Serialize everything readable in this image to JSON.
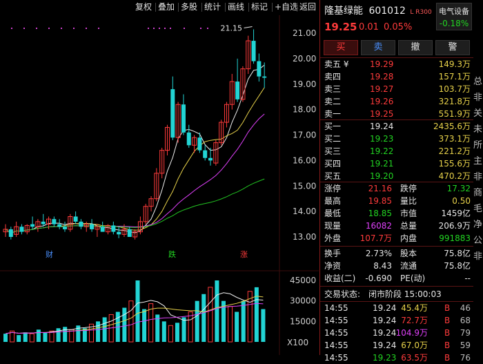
{
  "toolbar": {
    "buttons": [
      "复权",
      "叠加",
      "多股",
      "统计",
      "画线",
      "标记",
      "+自选",
      "返回"
    ]
  },
  "stock": {
    "name": "隆基绿能",
    "code": "601012",
    "tags": "L R300",
    "price": "19.25",
    "change": "0.01",
    "pct": "0.05%",
    "sector": "电气设备",
    "sector_pct": "-0.18%"
  },
  "trade_buttons": [
    "买",
    "卖",
    "撤",
    "警"
  ],
  "ask": [
    {
      "label": "卖五 ¥",
      "price": "19.29",
      "vol": "149.3万"
    },
    {
      "label": "卖四",
      "price": "19.28",
      "vol": "157.1万"
    },
    {
      "label": "卖三",
      "price": "19.27",
      "vol": "103.7万"
    },
    {
      "label": "卖二",
      "price": "19.26",
      "vol": "321.8万"
    },
    {
      "label": "卖一",
      "price": "19.25",
      "vol": "551.9万"
    }
  ],
  "bid": [
    {
      "label": "买一",
      "price": "19.24",
      "vol": "2435.6万"
    },
    {
      "label": "买二",
      "price": "19.23",
      "vol": "373.1万"
    },
    {
      "label": "买三",
      "price": "19.22",
      "vol": "221.2万"
    },
    {
      "label": "买四",
      "price": "19.21",
      "vol": "155.6万"
    },
    {
      "label": "买五",
      "price": "19.20",
      "vol": "470.2万"
    }
  ],
  "stats": [
    {
      "l1": "涨停",
      "v1": "21.16",
      "c1": "red",
      "l2": "跌停",
      "v2": "17.32",
      "c2": "green"
    },
    {
      "l1": "最高",
      "v1": "19.85",
      "c1": "red",
      "l2": "量比",
      "v2": "0.50",
      "c2": "yellow"
    },
    {
      "l1": "最低",
      "v1": "18.85",
      "c1": "green",
      "l2": "市值",
      "v2": "1459亿",
      "c2": "white"
    },
    {
      "l1": "现量",
      "v1": "16082",
      "c1": "mag",
      "l2": "总量",
      "v2": "206.9万",
      "c2": "white"
    },
    {
      "l1": "外盘",
      "v1": "107.7万",
      "c1": "red",
      "l2": "内盘",
      "v2": "991883",
      "c2": "green"
    }
  ],
  "stats2": [
    {
      "l1": "换手",
      "v1": "2.73%",
      "l2": "股本",
      "v2": "75.8亿"
    },
    {
      "l1": "净资",
      "v1": "8.43",
      "l2": "流通",
      "v2": "75.8亿"
    },
    {
      "l1": "收益(二)",
      "v1": "-0.690",
      "l2": "PE(动)",
      "v2": "--"
    }
  ],
  "status": {
    "label": "交易状态:",
    "value": "闭市阶段 15:00:03"
  },
  "ticks": [
    {
      "time": "14:55",
      "price": "19.24",
      "vol": "45.4万",
      "side": "B",
      "n": "46"
    },
    {
      "time": "14:55",
      "price": "19.24",
      "vol": "72.7万",
      "side": "B",
      "n": "68"
    },
    {
      "time": "14:55",
      "price": "19.24",
      "vol": "104.9万",
      "side": "B",
      "n": "79"
    },
    {
      "time": "14:55",
      "price": "19.24",
      "vol": "67.0万",
      "side": "B",
      "n": "59"
    },
    {
      "time": "14:55",
      "price": "19.23",
      "vol": "63.5万",
      "side": "B",
      "n": "76"
    }
  ],
  "edge_chars": [
    "总",
    "非",
    "关",
    "未",
    "所",
    "主",
    "非",
    "商",
    "毛",
    "净",
    "公",
    "非"
  ],
  "chart_data": {
    "type": "candlestick",
    "price_axis": {
      "labels": [
        "21.00",
        "20.00",
        "19.00",
        "18.00",
        "17.00",
        "16.00",
        "15.00",
        "14.00",
        "13.00"
      ],
      "values": [
        21,
        20,
        19,
        18,
        17,
        16,
        15,
        14,
        13
      ]
    },
    "volume_axis": {
      "labels": [
        "45000",
        "30000",
        "15000"
      ],
      "values": [
        45000,
        30000,
        15000
      ],
      "unit": "X100"
    },
    "peak_label": "21.15",
    "markers": [
      "财",
      "跌",
      "涨"
    ],
    "candles": [
      [
        13.2,
        13.5,
        13.0,
        13.3
      ],
      [
        13.3,
        13.4,
        12.9,
        13.0
      ],
      [
        13.1,
        13.6,
        13.0,
        13.4
      ],
      [
        13.4,
        13.5,
        13.1,
        13.2
      ],
      [
        13.2,
        13.5,
        13.1,
        13.45
      ],
      [
        13.5,
        13.8,
        13.3,
        13.4
      ],
      [
        13.4,
        13.7,
        13.2,
        13.6
      ],
      [
        13.6,
        13.9,
        13.4,
        13.5
      ],
      [
        13.5,
        13.8,
        13.3,
        13.7
      ],
      [
        13.7,
        13.8,
        13.4,
        13.5
      ],
      [
        13.5,
        13.7,
        13.3,
        13.4
      ],
      [
        13.4,
        13.6,
        13.2,
        13.3
      ],
      [
        13.3,
        13.9,
        13.2,
        13.8
      ],
      [
        13.8,
        14.0,
        13.5,
        13.6
      ],
      [
        13.6,
        13.7,
        13.3,
        13.4
      ],
      [
        13.4,
        13.6,
        13.2,
        13.5
      ],
      [
        13.5,
        13.7,
        13.2,
        13.3
      ],
      [
        13.3,
        13.5,
        13.0,
        13.4
      ],
      [
        13.4,
        13.6,
        13.2,
        13.2
      ],
      [
        13.2,
        13.5,
        13.1,
        13.45
      ],
      [
        13.45,
        13.6,
        13.1,
        13.2
      ],
      [
        13.2,
        13.4,
        12.95,
        13.1
      ],
      [
        13.1,
        13.5,
        13.0,
        13.3
      ],
      [
        13.3,
        13.4,
        13.0,
        13.0
      ],
      [
        13.0,
        13.3,
        12.9,
        13.2
      ],
      [
        13.2,
        13.8,
        13.1,
        13.6
      ],
      [
        13.6,
        14.3,
        13.5,
        14.2
      ],
      [
        14.2,
        14.6,
        14.0,
        14.5
      ],
      [
        14.5,
        15.7,
        14.4,
        15.5
      ],
      [
        15.5,
        16.5,
        15.3,
        16.4
      ],
      [
        16.4,
        17.4,
        16.2,
        17.3
      ],
      [
        18.8,
        19.3,
        16.8,
        16.9
      ],
      [
        16.9,
        18.3,
        16.7,
        18.2
      ],
      [
        18.2,
        18.6,
        17.0,
        17.1
      ],
      [
        17.1,
        17.4,
        16.5,
        16.6
      ],
      [
        16.6,
        17.0,
        16.3,
        16.9
      ],
      [
        16.9,
        17.1,
        16.3,
        16.4
      ],
      [
        16.4,
        16.6,
        16.0,
        16.1
      ],
      [
        16.1,
        16.5,
        15.8,
        16.0
      ],
      [
        15.9,
        16.8,
        15.8,
        16.7
      ],
      [
        16.7,
        17.6,
        16.6,
        17.5
      ],
      [
        17.5,
        18.3,
        17.3,
        18.2
      ],
      [
        18.2,
        19.4,
        18.0,
        19.1
      ],
      [
        19.1,
        20.0,
        18.3,
        18.4
      ],
      [
        18.4,
        19.7,
        18.3,
        19.6
      ],
      [
        19.6,
        20.9,
        19.4,
        20.7
      ],
      [
        20.7,
        21.15,
        19.8,
        19.9
      ],
      [
        19.9,
        20.2,
        19.1,
        19.3
      ],
      [
        19.3,
        19.85,
        18.85,
        19.25
      ]
    ],
    "volumes": [
      6000,
      8000,
      5000,
      7000,
      6000,
      9000,
      7000,
      8000,
      10000,
      11000,
      9000,
      12000,
      10000,
      13000,
      15000,
      18000,
      20000,
      22000,
      25000,
      30000,
      45000,
      24000,
      28000,
      20000,
      15000,
      12000,
      14000,
      18000,
      22000,
      30000,
      35000,
      40000,
      45000,
      30000,
      26000,
      22000,
      30000,
      37000,
      40000,
      24000
    ]
  }
}
